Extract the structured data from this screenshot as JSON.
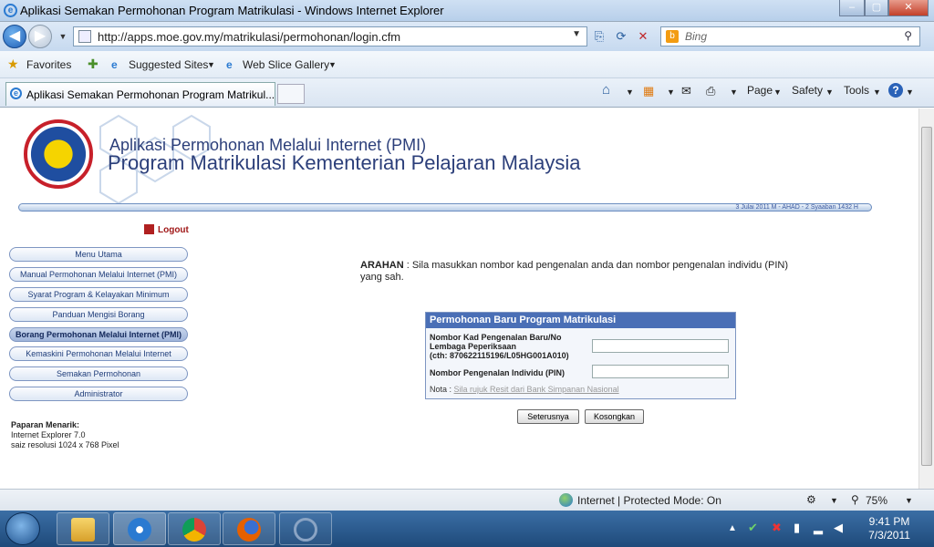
{
  "window": {
    "title": "Aplikasi Semakan Permohonan Program Matrikulasi - Windows Internet Explorer",
    "min": "–",
    "max": "▢",
    "close": "✕"
  },
  "address": {
    "url": "http://apps.moe.gov.my/matrikulasi/permohonan/login.cfm",
    "search_placeholder": "Bing"
  },
  "favorites": {
    "label": "Favorites",
    "suggested": "Suggested Sites",
    "slice": "Web Slice Gallery"
  },
  "tab": {
    "label": "Aplikasi Semakan Permohonan Program Matrikul..."
  },
  "commands": {
    "page": "Page",
    "safety": "Safety",
    "tools": "Tools",
    "help": "?"
  },
  "header": {
    "line1": "Aplikasi Permohonan Melalui Internet (PMI)",
    "line2": "Program Matrikulasi Kementerian Pelajaran Malaysia",
    "date": "3 Julai 2011 M - AHAD - 2 Syaaban 1432 H"
  },
  "logout": "Logout",
  "menu": [
    {
      "label": "Menu Utama"
    },
    {
      "label": "Manual Permohonan Melalui Internet (PMI)"
    },
    {
      "label": "Syarat Program & Kelayakan Minimum"
    },
    {
      "label": "Panduan Mengisi Borang"
    },
    {
      "label": "Borang Permohonan Melalui Internet (PMI)"
    },
    {
      "label": "Kemaskini Permohonan Melalui Internet"
    },
    {
      "label": "Semakan Permohonan"
    },
    {
      "label": "Administrator"
    }
  ],
  "paparan": {
    "title": "Paparan Menarik:",
    "line1": "Internet Explorer 7.0",
    "line2": "saiz resolusi 1024 x 768 Pixel"
  },
  "arahan": {
    "label": "ARAHAN",
    "text": ": Sila masukkan nombor kad pengenalan anda dan nombor pengenalan individu (PIN) yang sah."
  },
  "form": {
    "title": "Permohonan Baru Program Matrikulasi",
    "field1_line1": "Nombor Kad Pengenalan Baru/No",
    "field1_line2": "Lembaga Peperiksaan",
    "field1_line3": "(cth: 870622115196/L05HG001A010)",
    "field2": "Nombor Pengenalan Individu (PIN)",
    "nota_label": "Nota :",
    "nota_link": "Sila rujuk Resit dari Bank Simpanan Nasional"
  },
  "buttons": {
    "next": "Seterusnya",
    "clear": "Kosongkan"
  },
  "status": {
    "zone": "Internet | Protected Mode: On",
    "zoom": "75%"
  },
  "clock": {
    "time": "9:41 PM",
    "date": "7/3/2011"
  }
}
